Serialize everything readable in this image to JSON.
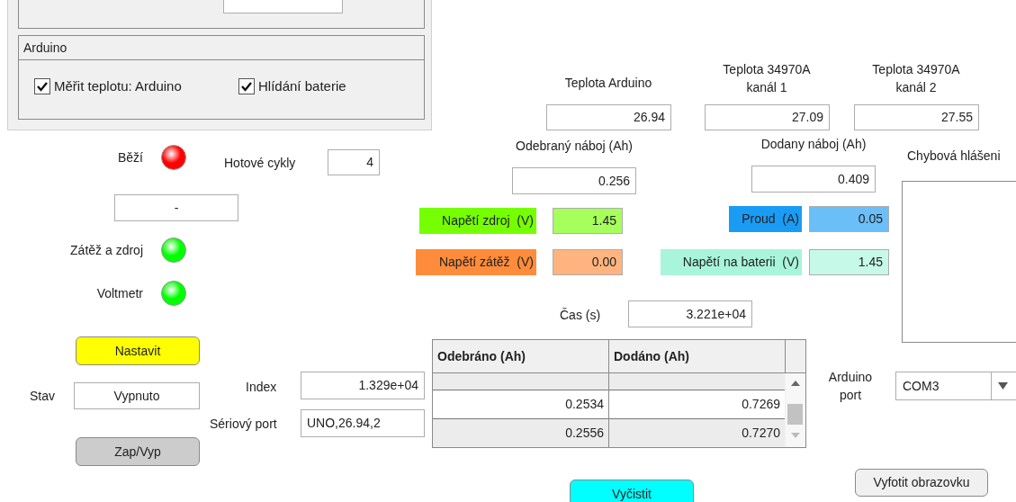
{
  "arduino_panel": {
    "title": "Arduino",
    "checkboxes": [
      {
        "label": "Měřit teplotu: Arduino",
        "checked": true
      },
      {
        "label": "Hlídání baterie",
        "checked": true
      }
    ]
  },
  "lamps": [
    {
      "label": "Běží",
      "color": "#ff0000"
    },
    {
      "label": "Zátěž a zdroj",
      "color": "#00ff00"
    },
    {
      "label": "Voltmetr",
      "color": "#00ff00"
    }
  ],
  "status_field": {
    "value": "-"
  },
  "cycles": {
    "label": "Hotové cykly",
    "value": "4"
  },
  "buttons": [
    {
      "kind": "set",
      "label": "Nastavit",
      "color": "#ffff00"
    },
    {
      "kind": "toggle",
      "label": "Zap/Vyp",
      "color": "#cccccc"
    },
    {
      "kind": "clear",
      "label": "Vyčistit",
      "color": "#00ffff"
    },
    {
      "kind": "screenshot",
      "label": "Vyfotit obrazovku",
      "color": "#f0f0f0"
    }
  ],
  "state": {
    "label": "Stav",
    "value": "Vypnuto"
  },
  "index": {
    "label": "Index",
    "value": "1.329e+04"
  },
  "serial_port": {
    "label": "Sériový port",
    "value": "UNO,26.94,2"
  },
  "temperatures": [
    {
      "label": "Teplota Arduino",
      "value": "26.94"
    },
    {
      "label": "Teplota 34970A kanál 1",
      "value": "27.09"
    },
    {
      "label": "Teplota 34970A kanál 2",
      "value": "27.55"
    }
  ],
  "charges": [
    {
      "label": "Odebraný náboj (Ah)",
      "value": "0.256"
    },
    {
      "label": "Dodany náboj (Ah)",
      "value": "0.409"
    }
  ],
  "readings": [
    {
      "label": "Napětí zdroj  (V)",
      "value": "1.45",
      "color": "#76ff03"
    },
    {
      "label": "Proud  (A)",
      "value": "0.05",
      "color": "#1a9cf5"
    },
    {
      "label": "Napětí zátěž  (V)",
      "value": "0.00",
      "color": "#ff8c3a"
    },
    {
      "label": "Napětí na baterii  (V)",
      "value": "1.45",
      "color": "#a8f5dc"
    }
  ],
  "error_messages": {
    "label": "Chybová hlášeni"
  },
  "time": {
    "label": "Čas (s)",
    "value": "3.221e+04"
  },
  "table": {
    "columns": [
      "Odebráno (Ah)",
      "Dodáno (Ah)"
    ],
    "rows": [
      [
        "0.2534",
        "0.7269"
      ],
      [
        "0.2556",
        "0.7270"
      ]
    ]
  },
  "arduino_port": {
    "label": "Arduino port",
    "value": "COM3"
  }
}
